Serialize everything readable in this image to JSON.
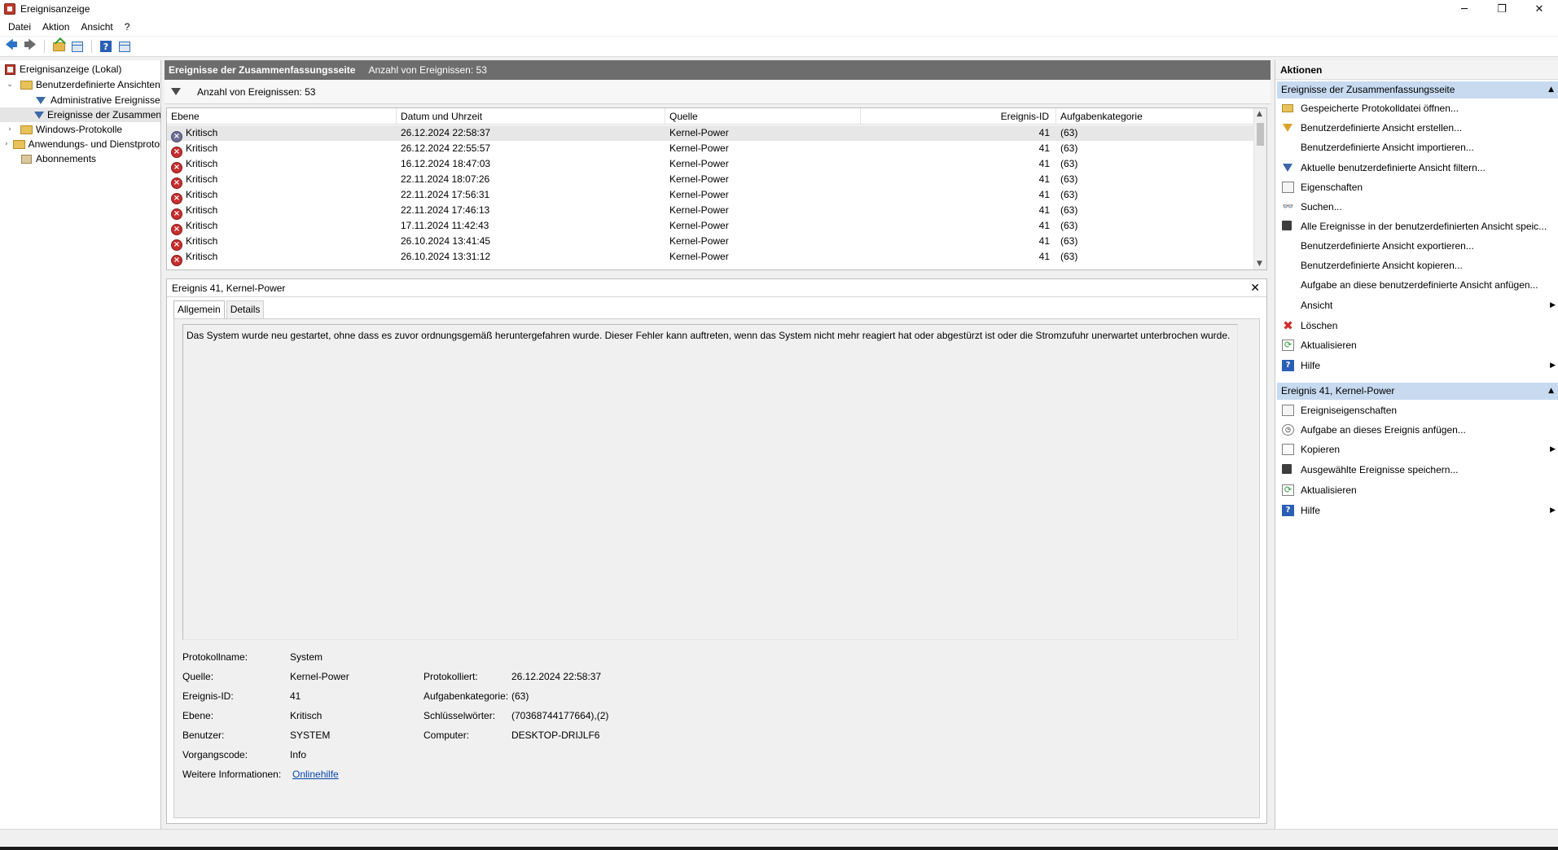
{
  "window": {
    "title": "Ereignisanzeige",
    "minimize": "─",
    "restore": "❐",
    "close": "✕"
  },
  "menu": [
    "Datei",
    "Aktion",
    "Ansicht",
    "?"
  ],
  "tree": {
    "items": [
      {
        "label": "Ereignisanzeige (Lokal)",
        "indent": 0,
        "expander": "",
        "icon": "event-viewer-icon"
      },
      {
        "label": "Benutzerdefinierte Ansichten",
        "indent": 1,
        "expander": "⌄",
        "icon": "folder-icon"
      },
      {
        "label": "Administrative Ereignisse",
        "indent": 2,
        "expander": "",
        "icon": "filter-icon"
      },
      {
        "label": "Ereignisse der Zusammenfassungsseite",
        "indent": 2,
        "expander": "",
        "icon": "filter-icon",
        "selected": true
      },
      {
        "label": "Windows-Protokolle",
        "indent": 1,
        "expander": "›",
        "icon": "folder-icon"
      },
      {
        "label": "Anwendungs- und Dienstprotokolle",
        "indent": 1,
        "expander": "›",
        "icon": "folder-icon"
      },
      {
        "label": "Abonnements",
        "indent": 1,
        "expander": "",
        "icon": "subscription-icon"
      }
    ]
  },
  "main": {
    "header_title": "Ereignisse der Zusammenfassungsseite",
    "header_count": "Anzahl von Ereignissen: 53",
    "filter_count": "Anzahl von Ereignissen: 53",
    "columns": [
      "Ebene",
      "Datum und Uhrzeit",
      "Quelle",
      "Ereignis-ID",
      "Aufgabenkategorie"
    ],
    "rows": [
      {
        "level": "Kritisch",
        "datetime": "26.12.2024 22:58:37",
        "source": "Kernel-Power",
        "id": "41",
        "category": "(63)"
      },
      {
        "level": "Kritisch",
        "datetime": "26.12.2024 22:55:57",
        "source": "Kernel-Power",
        "id": "41",
        "category": "(63)"
      },
      {
        "level": "Kritisch",
        "datetime": "16.12.2024 18:47:03",
        "source": "Kernel-Power",
        "id": "41",
        "category": "(63)"
      },
      {
        "level": "Kritisch",
        "datetime": "22.11.2024 18:07:26",
        "source": "Kernel-Power",
        "id": "41",
        "category": "(63)"
      },
      {
        "level": "Kritisch",
        "datetime": "22.11.2024 17:56:31",
        "source": "Kernel-Power",
        "id": "41",
        "category": "(63)"
      },
      {
        "level": "Kritisch",
        "datetime": "22.11.2024 17:46:13",
        "source": "Kernel-Power",
        "id": "41",
        "category": "(63)"
      },
      {
        "level": "Kritisch",
        "datetime": "17.11.2024 11:42:43",
        "source": "Kernel-Power",
        "id": "41",
        "category": "(63)"
      },
      {
        "level": "Kritisch",
        "datetime": "26.10.2024 13:41:45",
        "source": "Kernel-Power",
        "id": "41",
        "category": "(63)"
      },
      {
        "level": "Kritisch",
        "datetime": "26.10.2024 13:31:12",
        "source": "Kernel-Power",
        "id": "41",
        "category": "(63)"
      }
    ]
  },
  "detail": {
    "title": "Ereignis 41, Kernel-Power",
    "close": "✕",
    "tabs": [
      "Allgemein",
      "Details"
    ],
    "description": "Das System wurde neu gestartet, ohne dass es zuvor ordnungsgemäß heruntergefahren wurde. Dieser Fehler kann auftreten, wenn das System nicht mehr reagiert hat oder abgestürzt ist oder die Stromzufuhr unerwartet unterbrochen wurde.",
    "props": {
      "log_name_label": "Protokollname:",
      "log_name": "System",
      "source_label": "Quelle:",
      "source": "Kernel-Power",
      "logged_label": "Protokolliert:",
      "logged": "26.12.2024 22:58:37",
      "event_id_label": "Ereignis-ID:",
      "event_id": "41",
      "task_cat_label": "Aufgabenkategorie:",
      "task_cat": "(63)",
      "level_label": "Ebene:",
      "level": "Kritisch",
      "keywords_label": "Schlüsselwörter:",
      "keywords": "(70368744177664),(2)",
      "user_label": "Benutzer:",
      "user": "SYSTEM",
      "computer_label": "Computer:",
      "computer": "DESKTOP-DRIJLF6",
      "opcode_label": "Vorgangscode:",
      "opcode": "Info",
      "more_info_label": "Weitere Informationen:",
      "more_info_link": "Onlinehilfe"
    }
  },
  "actions": {
    "title": "Aktionen",
    "section1": "Ereignisse der Zusammenfassungsseite",
    "section1_items": [
      {
        "label": "Gespeicherte Protokolldatei öffnen...",
        "icon": "open-icon"
      },
      {
        "label": "Benutzerdefinierte Ansicht erstellen...",
        "icon": "create-view-icon"
      },
      {
        "label": "Benutzerdefinierte Ansicht importieren...",
        "icon": ""
      },
      {
        "label": "Aktuelle benutzerdefinierte Ansicht filtern...",
        "icon": "filter-icon"
      },
      {
        "label": "Eigenschaften",
        "icon": "properties-icon"
      },
      {
        "label": "Suchen...",
        "icon": "find-icon"
      },
      {
        "label": "Alle Ereignisse in der benutzerdefinierten Ansicht speic...",
        "icon": "save-icon"
      },
      {
        "label": "Benutzerdefinierte Ansicht exportieren...",
        "icon": ""
      },
      {
        "label": "Benutzerdefinierte Ansicht kopieren...",
        "icon": ""
      },
      {
        "label": "Aufgabe an diese benutzerdefinierte Ansicht anfügen...",
        "icon": ""
      },
      {
        "label": "Ansicht",
        "icon": "",
        "submenu": true
      },
      {
        "label": "Löschen",
        "icon": "delete-icon"
      },
      {
        "label": "Aktualisieren",
        "icon": "refresh-icon"
      },
      {
        "label": "Hilfe",
        "icon": "help-icon",
        "submenu": true
      }
    ],
    "section2": "Ereignis 41, Kernel-Power",
    "section2_items": [
      {
        "label": "Ereigniseigenschaften",
        "icon": "properties-icon"
      },
      {
        "label": "Aufgabe an dieses Ereignis anfügen...",
        "icon": "task-icon"
      },
      {
        "label": "Kopieren",
        "icon": "copy-icon",
        "submenu": true
      },
      {
        "label": "Ausgewählte Ereignisse speichern...",
        "icon": "save-icon"
      },
      {
        "label": "Aktualisieren",
        "icon": "refresh-icon"
      },
      {
        "label": "Hilfe",
        "icon": "help-icon",
        "submenu": true
      }
    ]
  }
}
